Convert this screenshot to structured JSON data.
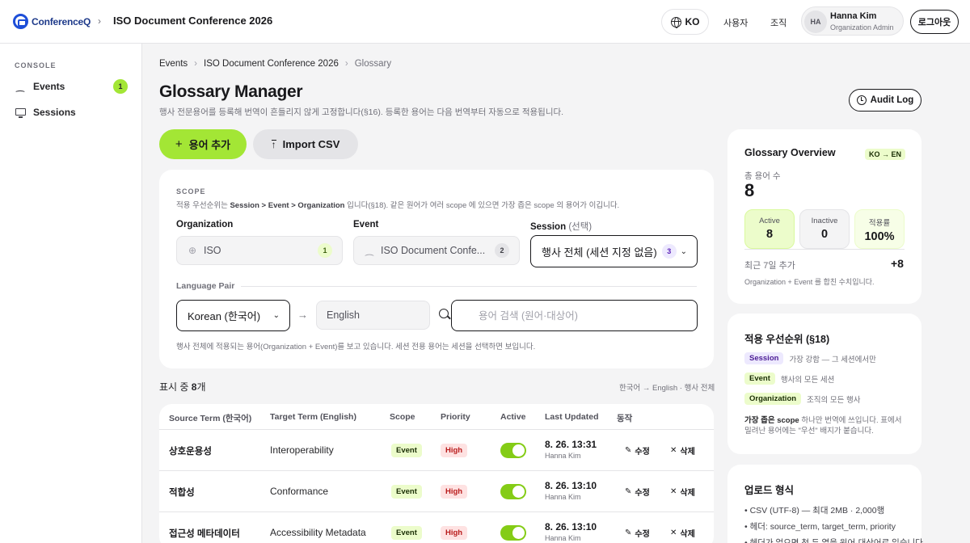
{
  "header": {
    "logo_text": "ConferenceQ",
    "app_title": "ISO Document Conference 2026",
    "lang": "KO",
    "nav": [
      "사용자",
      "조직"
    ],
    "user": {
      "initials": "HA",
      "name": "Hanna Kim",
      "role": "Organization Admin"
    },
    "logout": "로그아웃"
  },
  "sidebar": {
    "section": "CONSOLE",
    "items": [
      {
        "label": "Events",
        "badge": "1"
      },
      {
        "label": "Sessions"
      }
    ]
  },
  "breadcrumb": [
    "Events",
    "ISO Document Conference 2026",
    "Glossary"
  ],
  "page": {
    "title": "Glossary Manager",
    "desc": "행사 전문용어를 등록해 번역이 흔들리지 않게 고정합니다(§16). 등록한 용어는 다음 번역부터 자동으로 적용됩니다.",
    "audit": "Audit Log",
    "add": "용어 추가",
    "import": "Import CSV"
  },
  "scope": {
    "label": "SCOPE",
    "note_pre": "적용 우선순위는 ",
    "note_bold": "Session > Event > Organization",
    "note_post": " 입니다(§18). 같은 원어가 여러 scope 에 있으면 가장 좁은 scope 의 용어가 이깁니다.",
    "org_label": "Organization",
    "org_value": "ISO",
    "org_count": "1",
    "event_label": "Event",
    "event_value": "ISO Document Confe...",
    "event_count": "2",
    "session_label": "Session",
    "session_opt": "(선택)",
    "session_value": "행사 전체 (세션 지정 없음)",
    "session_count": "3",
    "lp_label": "Language Pair",
    "source_lang": "Korean (한국어)",
    "target_lang": "English",
    "search_placeholder": "용어 검색 (원어·대상어)",
    "foot": "행사 전체에 적용되는 용어(Organization + Event)를 보고 있습니다. 세션 전용 용어는 세션을 선택하면 보입니다."
  },
  "count": {
    "pre": "표시 중 ",
    "num": "8",
    "post": "개",
    "filter": "한국어 → English · 행사 전체"
  },
  "table": {
    "headers": [
      "Source Term (한국어)",
      "Target Term (English)",
      "Scope",
      "Priority",
      "Active",
      "Last Updated",
      "동작"
    ],
    "edit": "수정",
    "delete": "삭제",
    "rows": [
      {
        "source": "상호운용성",
        "target": "Interoperability",
        "scope": "Event",
        "priority": "High",
        "date": "8. 26. 13:31",
        "user": "Hanna Kim"
      },
      {
        "source": "적합성",
        "target": "Conformance",
        "scope": "Event",
        "priority": "High",
        "date": "8. 26. 13:10",
        "user": "Hanna Kim"
      },
      {
        "source": "접근성 메타데이터",
        "target": "Accessibility Metadata",
        "scope": "Event",
        "priority": "High",
        "date": "8. 26. 13:10",
        "user": "Hanna Kim"
      }
    ]
  },
  "overview": {
    "title": "Glossary Overview",
    "lang": "KO → EN",
    "total_label": "총 용어 수",
    "total": "8",
    "stats": [
      {
        "label": "Active",
        "value": "8"
      },
      {
        "label": "Inactive",
        "value": "0"
      },
      {
        "label": "적용률",
        "value": "100%"
      }
    ],
    "week_label": "최근 7일 추가",
    "week_value": "+8",
    "note": "Organization + Event 를 합친 수치입니다."
  },
  "priority": {
    "title": "적용 우선순위 (§18)",
    "rows": [
      {
        "tag": "Session",
        "desc": "가장 강함 — 그 세션에서만"
      },
      {
        "tag": "Event",
        "desc": "행사의 모든 세션"
      },
      {
        "tag": "Organization",
        "desc": "조직의 모든 행사"
      }
    ],
    "note_bold": "가장 좁은 scope",
    "note_rest": " 하나만 번역에 쓰입니다. 표에서 밀려난 용어에는 \"우선\" 배지가 붙습니다."
  },
  "upload": {
    "title": "업로드 형식",
    "items": [
      "• CSV (UTF-8) — 최대 2MB · 2,000행",
      "• 헤더: source_term, target_term, priority",
      "• 헤더가 없으면 첫 두 열을 원어·대상어로 읽습니다"
    ]
  }
}
